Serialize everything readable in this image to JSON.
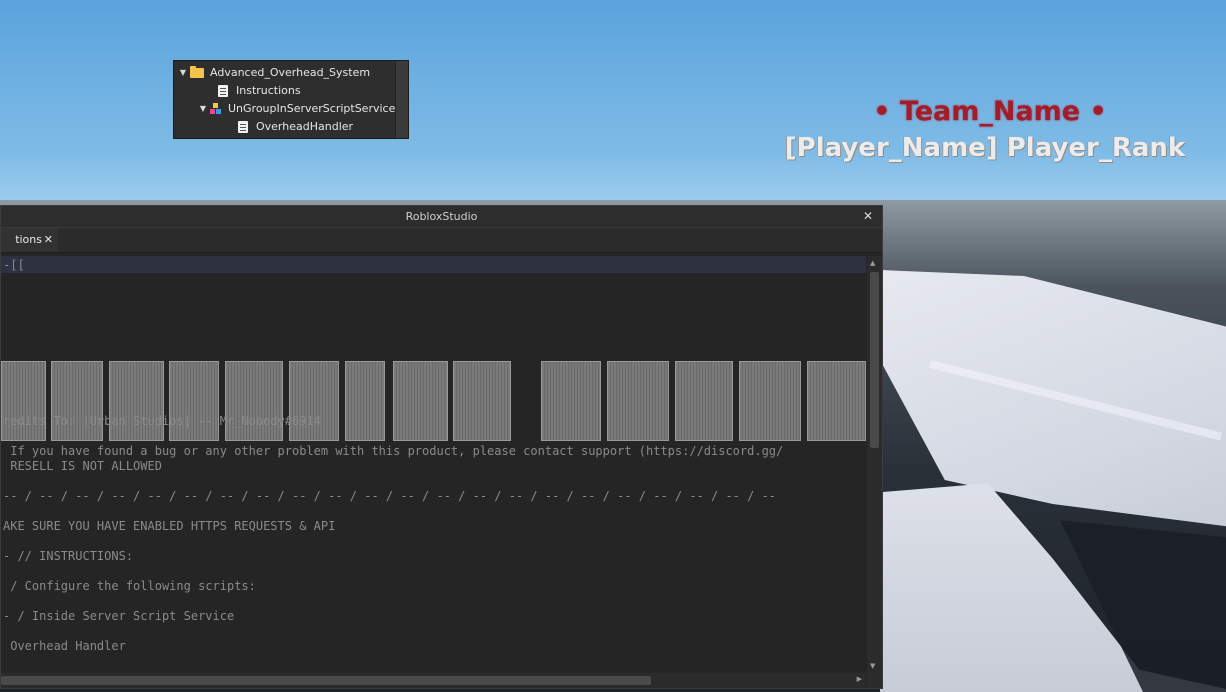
{
  "explorer": {
    "items": [
      {
        "label": "Advanced_Overhead_System",
        "icon": "folder-icon",
        "expanded": true
      },
      {
        "label": "Instructions",
        "icon": "script-icon"
      },
      {
        "label": "UnGroupInServerScriptService",
        "icon": "model-icon",
        "expanded": true
      },
      {
        "label": "OverheadHandler",
        "icon": "script-icon"
      }
    ]
  },
  "billboard": {
    "team_name": "• Team_Name •",
    "player_line": "[Player_Name] Player_Rank",
    "team_color": "#a01d2b"
  },
  "window": {
    "title": "RobloxStudio",
    "tab_label": "tions"
  },
  "code": {
    "line_first": "-[[",
    "credits": "redits To: |Urban Studios| -- Mr_Nobody#6914",
    "bug_line": " If you have found a bug or any other problem with this product, please contact support (https://discord.gg/",
    "resell": " RESELL IS NOT ALLOWED",
    "divider": "-- / -- / -- / -- / -- / -- / -- / -- / -- / -- / -- / -- / -- / -- / -- / -- / -- / -- / -- / -- / -- / --",
    "https_line": "AKE SURE YOU HAVE ENABLED HTTPS REQUESTS & API",
    "instructions": "- // INSTRUCTIONS:",
    "configure": " / Configure the following scripts:",
    "inside": "- / Inside Server Script Service",
    "handler": " Overhead Handler"
  }
}
